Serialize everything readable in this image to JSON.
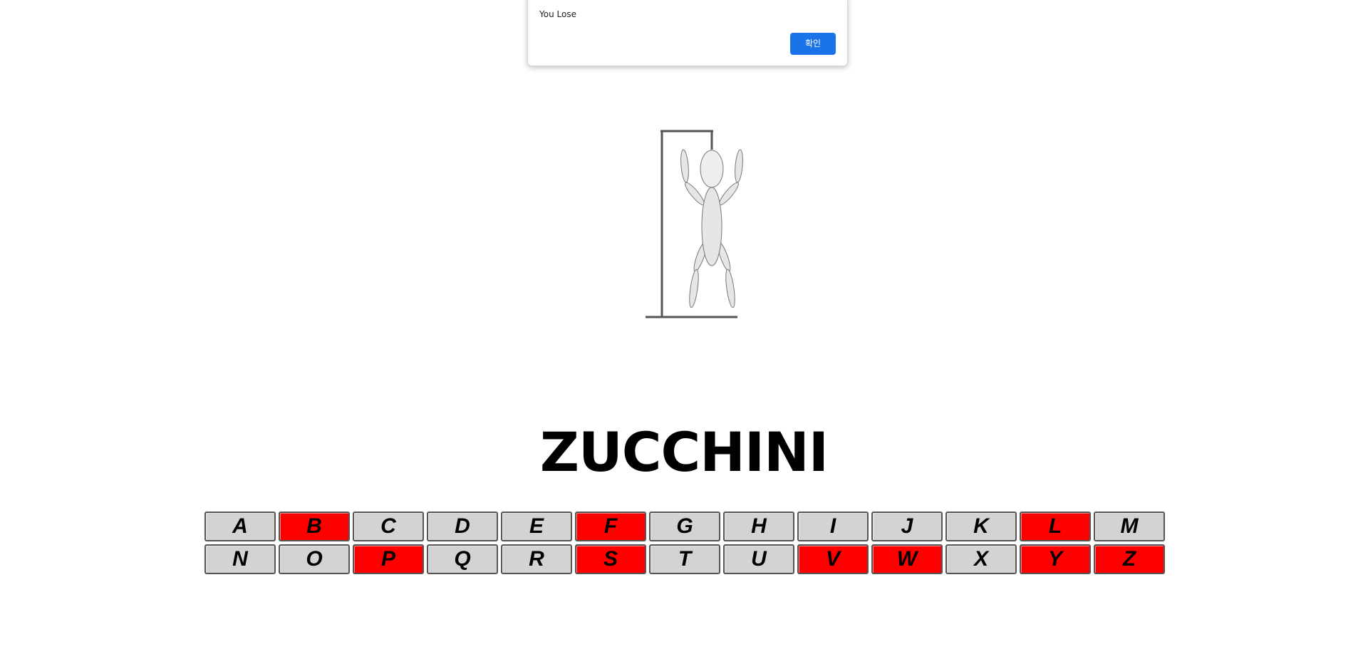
{
  "dialog": {
    "message": "You Lose",
    "ok_label": "확인"
  },
  "game": {
    "word": "ZUCCHINI",
    "wrong_guess_color": "#ff0000",
    "unused_key_color": "#d3d3d3"
  },
  "keyboard": {
    "rows": [
      [
        {
          "letter": "A",
          "used": false
        },
        {
          "letter": "B",
          "used": true
        },
        {
          "letter": "C",
          "used": false
        },
        {
          "letter": "D",
          "used": false
        },
        {
          "letter": "E",
          "used": false
        },
        {
          "letter": "F",
          "used": true
        },
        {
          "letter": "G",
          "used": false
        },
        {
          "letter": "H",
          "used": false
        },
        {
          "letter": "I",
          "used": false
        },
        {
          "letter": "J",
          "used": false
        },
        {
          "letter": "K",
          "used": false
        },
        {
          "letter": "L",
          "used": true
        },
        {
          "letter": "M",
          "used": false
        }
      ],
      [
        {
          "letter": "N",
          "used": false
        },
        {
          "letter": "O",
          "used": false
        },
        {
          "letter": "P",
          "used": true
        },
        {
          "letter": "Q",
          "used": false
        },
        {
          "letter": "R",
          "used": false
        },
        {
          "letter": "S",
          "used": true
        },
        {
          "letter": "T",
          "used": false
        },
        {
          "letter": "U",
          "used": false
        },
        {
          "letter": "V",
          "used": true
        },
        {
          "letter": "W",
          "used": true
        },
        {
          "letter": "X",
          "used": false
        },
        {
          "letter": "Y",
          "used": true
        },
        {
          "letter": "Z",
          "used": true
        }
      ]
    ]
  }
}
